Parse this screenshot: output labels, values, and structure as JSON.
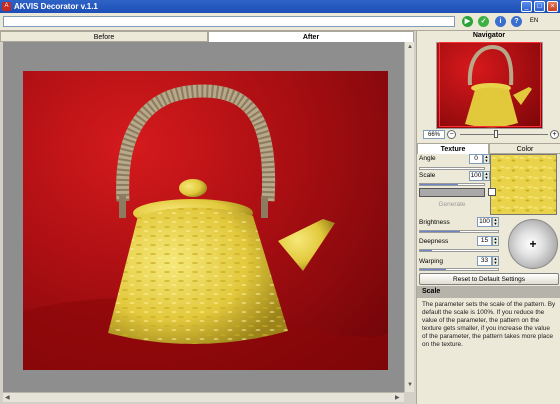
{
  "window": {
    "title": "AKVIS Decorator v.1.1",
    "min": "_",
    "max": "□",
    "close": "×"
  },
  "toolbar": {
    "run": "▶",
    "apply": "✓",
    "about": "i",
    "help": "?",
    "language": "EN"
  },
  "view_tabs": [
    {
      "label": "Before"
    },
    {
      "label": "After"
    }
  ],
  "navigator": {
    "title": "Navigator",
    "zoom": "66%",
    "zoom_out": "−",
    "zoom_in": "+"
  },
  "param_tabs": [
    {
      "label": "Texture"
    },
    {
      "label": "Color"
    }
  ],
  "texture": {
    "angle_label": "Angle",
    "angle": "0",
    "scale_label": "Scale",
    "scale": "100",
    "generate": "Generate"
  },
  "lighting": {
    "brightness_label": "Brightness",
    "brightness": "100",
    "deepness_label": "Deepness",
    "deepness": "15",
    "warping_label": "Warping",
    "warping": "33",
    "light_cross": "+"
  },
  "reset_label": "Reset to Default Settings",
  "help": {
    "title": "Scale",
    "text": "The parameter sets the scale of the pattern. By default the scale is 100%. If you reduce the value of the parameter, the pattern on the texture gets smaller, if you increase the value of the parameter, the pattern takes more place on the texture."
  },
  "colors": {
    "title_bar": "#1d4fb6",
    "background": "#d51a1d",
    "teapot": "#e9d34b"
  }
}
